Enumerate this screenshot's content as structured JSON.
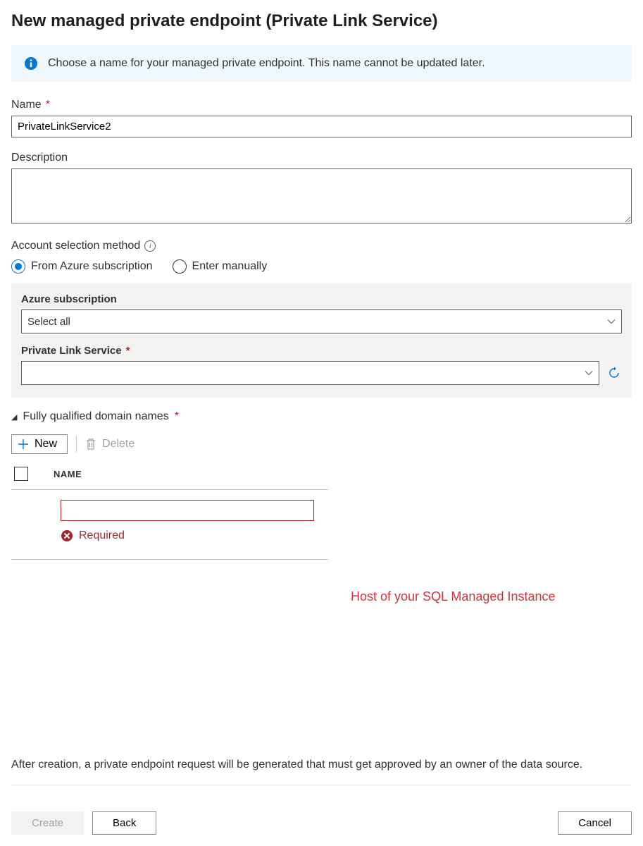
{
  "header": {
    "title": "New managed private endpoint (Private Link Service)"
  },
  "info_banner": {
    "text": "Choose a name for your managed private endpoint. This name cannot be updated later."
  },
  "fields": {
    "name": {
      "label": "Name",
      "value": "PrivateLinkService2"
    },
    "description": {
      "label": "Description",
      "value": ""
    },
    "account_method": {
      "label": "Account selection method",
      "options": {
        "from_azure": "From Azure subscription",
        "manual": "Enter manually"
      },
      "selected": "from_azure"
    },
    "azure_subscription": {
      "label": "Azure subscription",
      "value": "Select all"
    },
    "private_link_service": {
      "label": "Private Link Service",
      "value": ""
    }
  },
  "fqdn": {
    "header": "Fully qualified domain names",
    "toolbar": {
      "new_label": "New",
      "delete_label": "Delete"
    },
    "column_name": "NAME",
    "row_value": "",
    "error": "Required"
  },
  "annotation": {
    "text": "Host of your SQL Managed Instance"
  },
  "footer": {
    "note": "After creation, a private endpoint request will be generated that must get approved by an owner of the data source.",
    "buttons": {
      "create": "Create",
      "back": "Back",
      "cancel": "Cancel"
    }
  }
}
